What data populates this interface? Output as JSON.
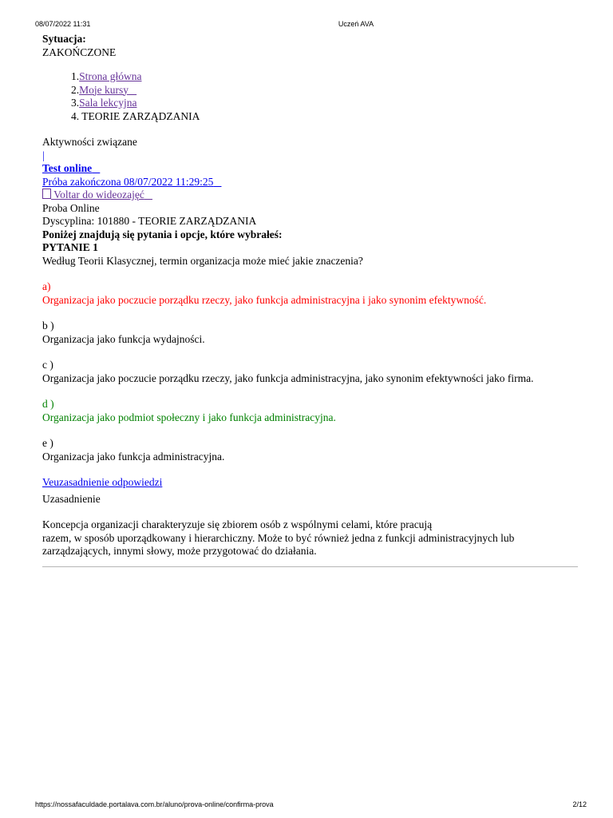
{
  "header": {
    "datetime": "08/07/2022 11:31",
    "title": "Uczeń AVA"
  },
  "footer": {
    "url": "https://nossafaculdade.portalava.com.br/aluno/prova-online/confirma-prova",
    "page": "2/12"
  },
  "situation": {
    "label": "Sytuacja:",
    "value": "ZAKOŃCZONE"
  },
  "breadcrumb": [
    {
      "num": "1.",
      "label": "Strona główna"
    },
    {
      "num": "2.",
      "label": "Moje kursy"
    },
    {
      "num": "3.",
      "label": "Sala lekcyjna"
    },
    {
      "num": "4. ",
      "label": "TEORIE ZARZĄDZANIA"
    }
  ],
  "activities": {
    "heading": "Aktywności związane",
    "cursor": "|",
    "test_link": "Test online",
    "attempt_link": "Próba zakończona 08/07/2022 11:29:25",
    "back_icon": "arrow-left-icon",
    "back_link": " Voltar do wideozajęć"
  },
  "exam": {
    "type": "Proba Online",
    "discipline": "Dyscyplina: 101880 - TEORIE ZARZĄDZANIA",
    "intro": "Poniżej znajdują się pytania i opcje, które wybrałeś:",
    "question_label": "PYTANIE 1",
    "question_text": "Według Teorii Klasycznej, termin organizacja może mieć jakie znaczenia?"
  },
  "options": [
    {
      "letter": "a)",
      "text": "Organizacja jako poczucie porządku rzeczy, jako funkcja administracyjna i jako synonim efektywność.",
      "status": "wrong",
      "color": "#ff0000"
    },
    {
      "letter": "b )",
      "text": "Organizacja jako funkcja wydajności.",
      "status": "neutral",
      "color": "#000000"
    },
    {
      "letter": "c )",
      "text": "Organizacja jako poczucie porządku rzeczy, jako funkcja administracyjna, jako synonim efektywności jako firma.",
      "status": "neutral",
      "color": "#000000"
    },
    {
      "letter": "d )",
      "text": "Organizacja jako podmiot społeczny i jako funkcja administracyjna.",
      "status": "correct",
      "color": "#008000"
    },
    {
      "letter": "e )",
      "text": "Organizacja jako funkcja administracyjna.",
      "status": "neutral",
      "color": "#000000"
    }
  ],
  "justification": {
    "link": "Veuzasadnienie odpowiedzi",
    "heading": "Uzasadnienie",
    "line1": "Koncepcja organizacji charakteryzuje się zbiorem osób z wspólnymi celami, które pracują",
    "line2": "razem, w sposób uporządkowany i hierarchiczny. Może to być również jedna z funkcji administracyjnych lub zarządzających, innymi słowy, może przygotować do działania."
  }
}
